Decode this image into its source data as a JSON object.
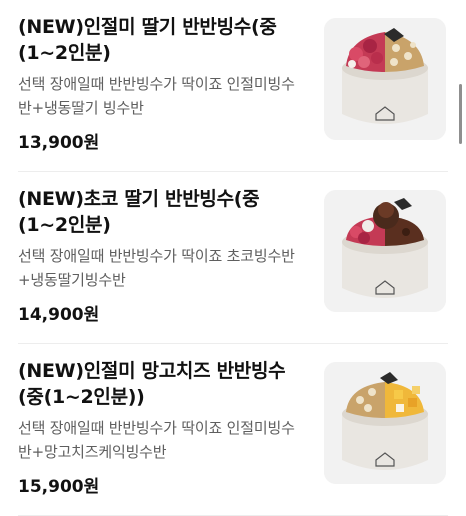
{
  "menu_items": [
    {
      "title": "(NEW)인절미 딸기 반반빙수(중(1~2인분)",
      "description": "선택 장애일때 반반빙수가 딱이죠 인절미빙수반+냉동딸기 빙수반",
      "price": "13,900원"
    },
    {
      "title": "(NEW)초코 딸기 반반빙수(중(1~2인분)",
      "description": "선택 장애일때 반반빙수가 딱이죠 초코빙수반+냉동딸기빙수반",
      "price": "14,900원"
    },
    {
      "title": "(NEW)인절미 망고치즈 반반빙수(중(1~2인분))",
      "description": "선택 장애일때 반반빙수가 딱이죠 인절미빙수반+망고치즈케익빙수반",
      "price": "15,900원"
    }
  ]
}
